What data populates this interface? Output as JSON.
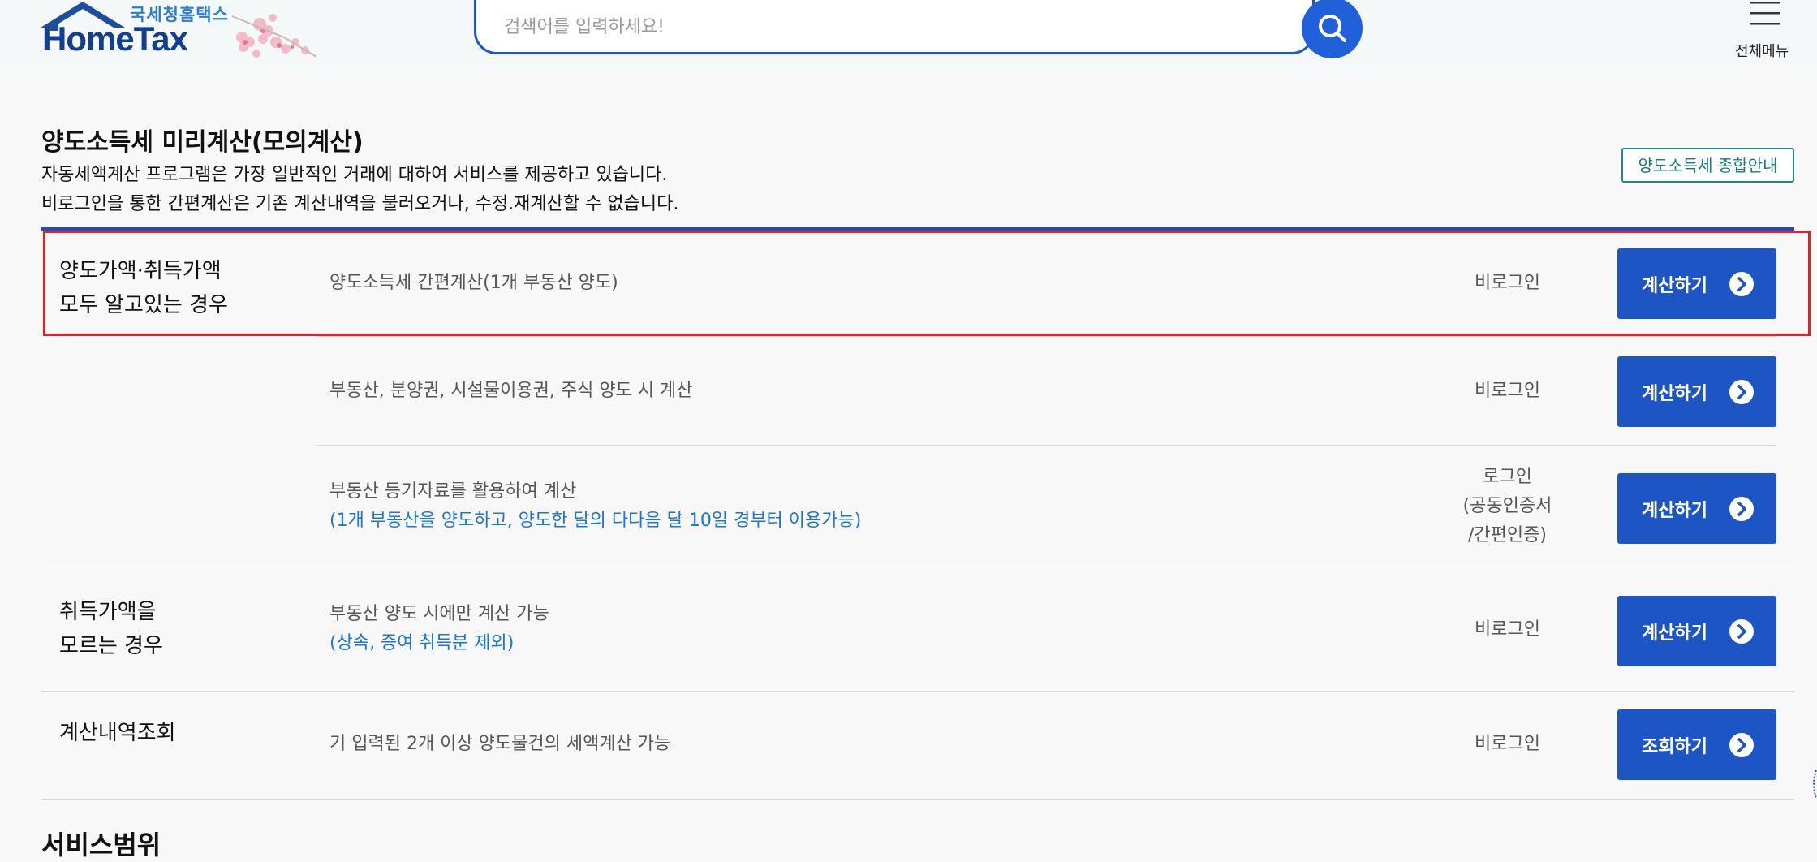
{
  "header": {
    "logo_sub": "국세청홈택스",
    "logo_main": "HomeTax",
    "search_placeholder": "검색어를 입력하세요!",
    "search_icon": "search-icon",
    "menu_label": "전체메뉴",
    "menu_icon": "hamburger-icon"
  },
  "page": {
    "title": "양도소득세 미리계산(모의계산)",
    "desc1": "자동세액계산 프로그램은 가장 일반적인 거래에 대하여 서비스를 제공하고 있습니다.",
    "desc2": "비로그인을 통한 간편계산은 기존 계산내역을 불러오거나, 수정.재계산할 수 없습니다.",
    "guide_button": "양도소득세 종합안내"
  },
  "categories": {
    "known": {
      "line1": "양도가액·취득가액",
      "line2": "모두 알고있는 경우"
    },
    "unknown": {
      "line1": "취득가액을",
      "line2": "모르는 경우"
    },
    "history": {
      "line1": "계산내역조회"
    }
  },
  "rows": [
    {
      "service": "양도소득세 간편계산(1개 부동산 양도)",
      "login": "비로그인",
      "button": "계산하기"
    },
    {
      "service": "부동산, 분양권, 시설물이용권, 주식 양도 시 계산",
      "login": "비로그인",
      "button": "계산하기"
    },
    {
      "service": "부동산 등기자료를 활용하여 계산",
      "note": "(1개 부동산을 양도하고, 양도한 달의 다다음 달 10일 경부터 이용가능)",
      "login_lines": [
        "로그인",
        "(공동인증서",
        "/간편인증)"
      ],
      "button": "계산하기"
    },
    {
      "service": "부동산 양도 시에만 계산 가능",
      "note": "(상속, 증여 취득분 제외)",
      "login": "비로그인",
      "button": "계산하기"
    },
    {
      "service": "기 입력된 2개 이상 양도물건의 세액계산 가능",
      "login": "비로그인",
      "button": "조회하기"
    }
  ],
  "button_icon": "chevron-right-circle-icon",
  "section_heading": "서비스범위",
  "colors": {
    "primary": "#1e55c4",
    "accent_rule": "#2849b2",
    "highlight": "#d9232d",
    "note": "#1a73d9",
    "teal": "#147a7a"
  }
}
